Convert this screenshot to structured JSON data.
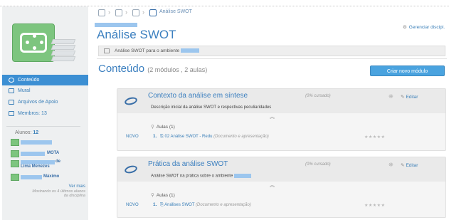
{
  "breadcrumb": {
    "current": "Análise SWOT",
    "icons": [
      "home-icon",
      "grid-icon",
      "branch-icon",
      "course-icon"
    ]
  },
  "sidebar": {
    "logo_icon": "app-logo-icon",
    "items": [
      {
        "label": "Conteúdo",
        "icon": "chain-link-icon",
        "active": true
      },
      {
        "label": "Mural",
        "icon": "board-icon",
        "active": false
      },
      {
        "label": "Arquivos de Apoio",
        "icon": "files-icon",
        "active": false
      },
      {
        "label": "Membros: 13",
        "icon": "members-icon",
        "active": false
      }
    ],
    "students_label": "Alunos:",
    "students_count": "12",
    "students": [
      {
        "name": "",
        "suffix": ""
      },
      {
        "name": "MOTA",
        "suffix": ""
      },
      {
        "name": "Lima Menezes",
        "suffix": "de"
      },
      {
        "name": "Máximo",
        "suffix": ""
      }
    ],
    "more_label": "Ver mais",
    "more_sub": "Mostrando os 4 últimos alunos da disciplina"
  },
  "header": {
    "title": "Análise SWOT",
    "manage_label": "Gerenciar discipl.",
    "subtitle": "Análise SWOT para o ambiente"
  },
  "content": {
    "heading": "Conteúdo",
    "summary": "(2 módulos , 2 aulas)",
    "create_button": "Criar novo módulo"
  },
  "modules": [
    {
      "title": "Contexto da análise em síntese",
      "progress": "(0% cursado)",
      "edit_label": "Editar",
      "description": "Descrição inicial da análise SWOT e respectivas peculiaridades",
      "aulas_label": "Aulas (1)",
      "lesson": {
        "badge": "NOVO",
        "number": "1.",
        "name": "02 Análise SWOT - Redu",
        "type": "(Documento e apresentação)",
        "stars": "★★★★★"
      }
    },
    {
      "title": "Prática da análise SWOT",
      "progress": "(0% cursado)",
      "edit_label": "Editar",
      "description": "Análise SWOT na prática sobre o ambiente",
      "aulas_label": "Aulas (1)",
      "lesson": {
        "badge": "NOVO",
        "number": "1.",
        "name": "Análises SWOT",
        "type": "(Documento e apresentação)",
        "stars": "★★★★★"
      }
    }
  ],
  "colors": {
    "accent": "#3b7fbf",
    "sidebar_active": "#3c8fd3",
    "button": "#4aa3df",
    "logo_green": "#7dc57f",
    "redaction": "#9cc6ee"
  }
}
